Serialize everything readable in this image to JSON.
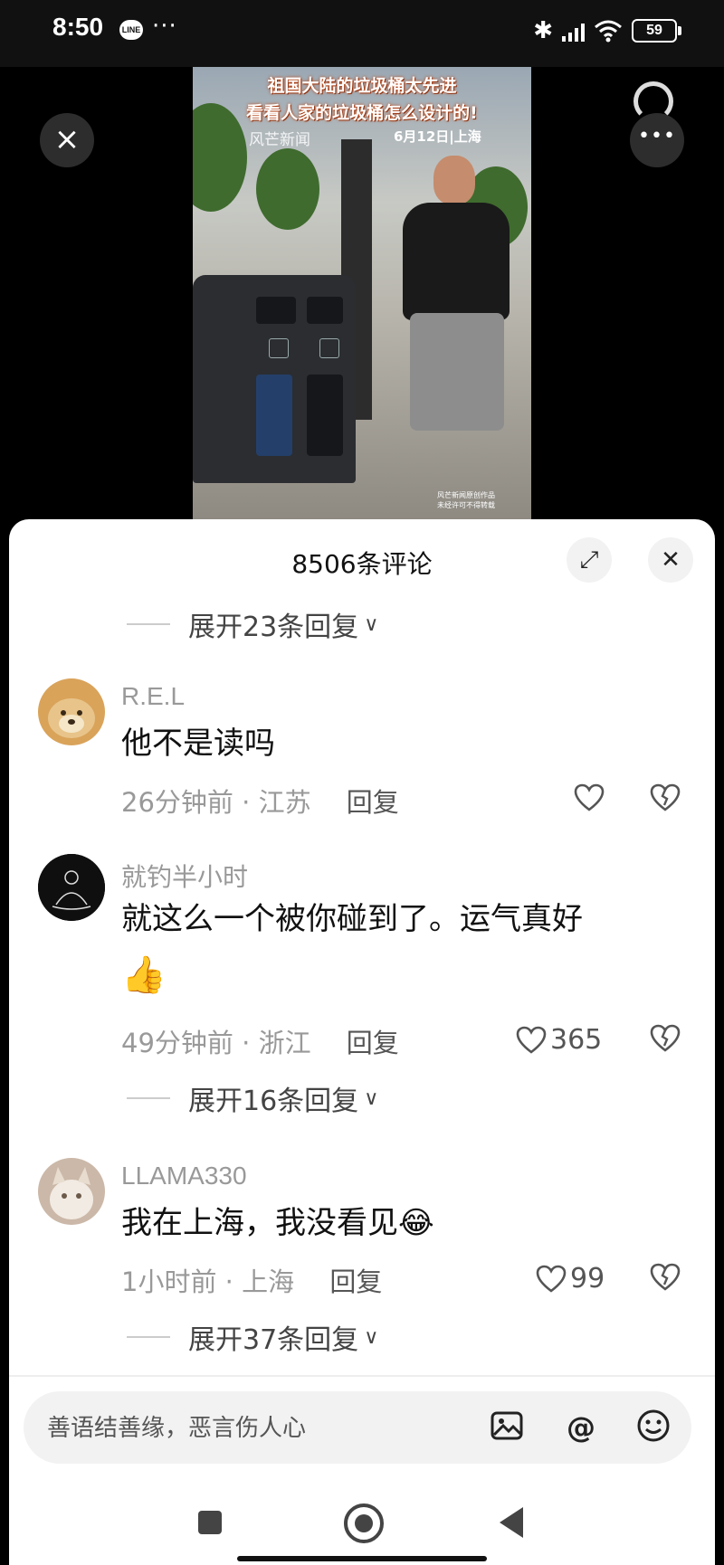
{
  "status_bar": {
    "time": "8:50",
    "app_badge": "LINE",
    "more": "···",
    "battery": "59"
  },
  "video": {
    "caption_line1": "祖国大陆的垃圾桶太先进",
    "caption_line2": "看看人家的垃圾桶怎么设计的!",
    "source": "风芒新闻",
    "date_location": "6月12日|上海",
    "watermark_line1": "风芒新闻原创作品",
    "watermark_line2": "未经许可不得转载"
  },
  "comments_panel": {
    "title": "8506条评论",
    "expand_icon": "⤢",
    "close_icon": "✕",
    "expand_top": "展开23条回复",
    "comments": [
      {
        "username": "R.E.L",
        "text": "他不是读吗",
        "time": "26分钟前",
        "location": "江苏",
        "reply_label": "回复",
        "likes": ""
      },
      {
        "username": "就钓半小时",
        "text": "就这么一个被你碰到了。运气真好",
        "emoji": "👍",
        "time": "49分钟前",
        "location": "浙江",
        "reply_label": "回复",
        "likes": "365",
        "expand": "展开16条回复"
      },
      {
        "username": "LLAMA330",
        "text": "我在上海，我没看见😂",
        "time": "1小时前",
        "location": "上海",
        "reply_label": "回复",
        "likes": "99",
        "expand": "展开37条回复"
      }
    ]
  },
  "input_bar": {
    "placeholder": "善语结善缘，恶言伤人心",
    "icons": [
      "image-icon",
      "at-icon",
      "emoji-icon"
    ]
  },
  "colors": {
    "sheet_bg": "#ffffff",
    "muted_text": "#999999",
    "input_bg": "#f2f2f2"
  }
}
